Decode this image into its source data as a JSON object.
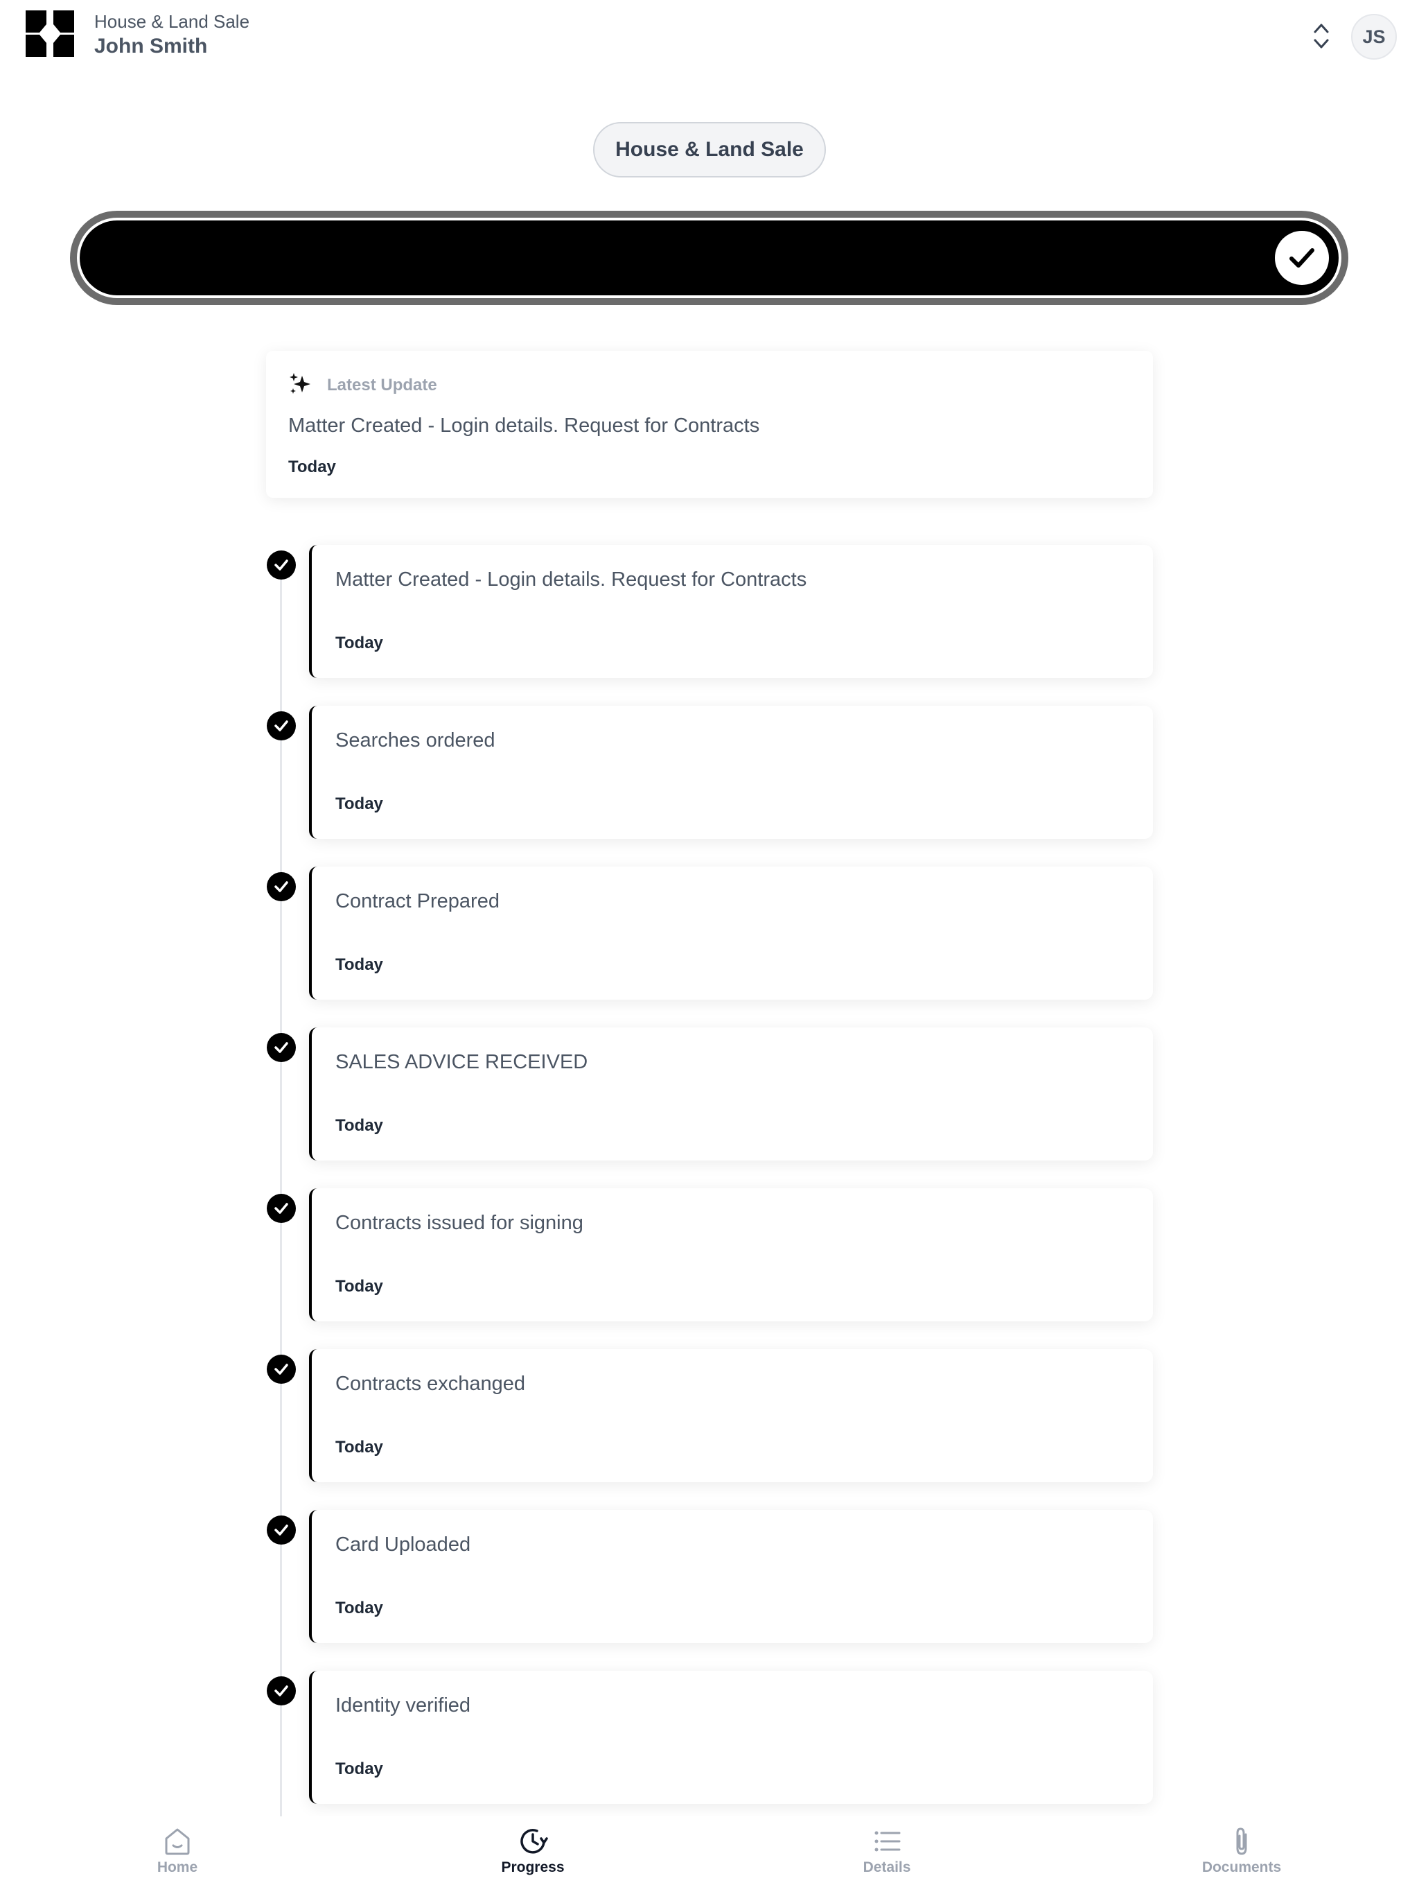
{
  "header": {
    "subtitle": "House & Land Sale",
    "user_name": "John Smith",
    "avatar_initials": "JS",
    "logo_icon": "brand-logo-icon",
    "switcher_icon": "chevron-up-down-icon"
  },
  "matter": {
    "pill_label": "House & Land Sale"
  },
  "progress": {
    "fraction_complete": 1.0,
    "status_icon": "check-icon",
    "fill_color": "#000000"
  },
  "latest_update": {
    "label": "Latest Update",
    "text": "Matter Created - Login details. Request for Contracts",
    "date": "Today",
    "icon": "sparkles-icon"
  },
  "steps": [
    {
      "title": "Matter Created - Login details. Request for Contracts",
      "date": "Today",
      "completed": true
    },
    {
      "title": "Searches ordered",
      "date": "Today",
      "completed": true
    },
    {
      "title": "Contract Prepared",
      "date": "Today",
      "completed": true
    },
    {
      "title": "SALES ADVICE RECEIVED",
      "date": "Today",
      "completed": true
    },
    {
      "title": "Contracts issued for signing",
      "date": "Today",
      "completed": true
    },
    {
      "title": "Contracts exchanged",
      "date": "Today",
      "completed": true
    },
    {
      "title": "Card Uploaded",
      "date": "Today",
      "completed": true
    },
    {
      "title": "Identity verified",
      "date": "Today",
      "completed": true
    }
  ],
  "bottom_nav": {
    "items": [
      {
        "label": "Home",
        "icon": "home-icon",
        "active": false
      },
      {
        "label": "Progress",
        "icon": "progress-clock-icon",
        "active": true
      },
      {
        "label": "Details",
        "icon": "list-icon",
        "active": false
      },
      {
        "label": "Documents",
        "icon": "paperclip-icon",
        "active": false
      }
    ]
  },
  "colors": {
    "accent": "#000000",
    "muted_text": "#9ca3af",
    "body_text": "#4b5563"
  }
}
